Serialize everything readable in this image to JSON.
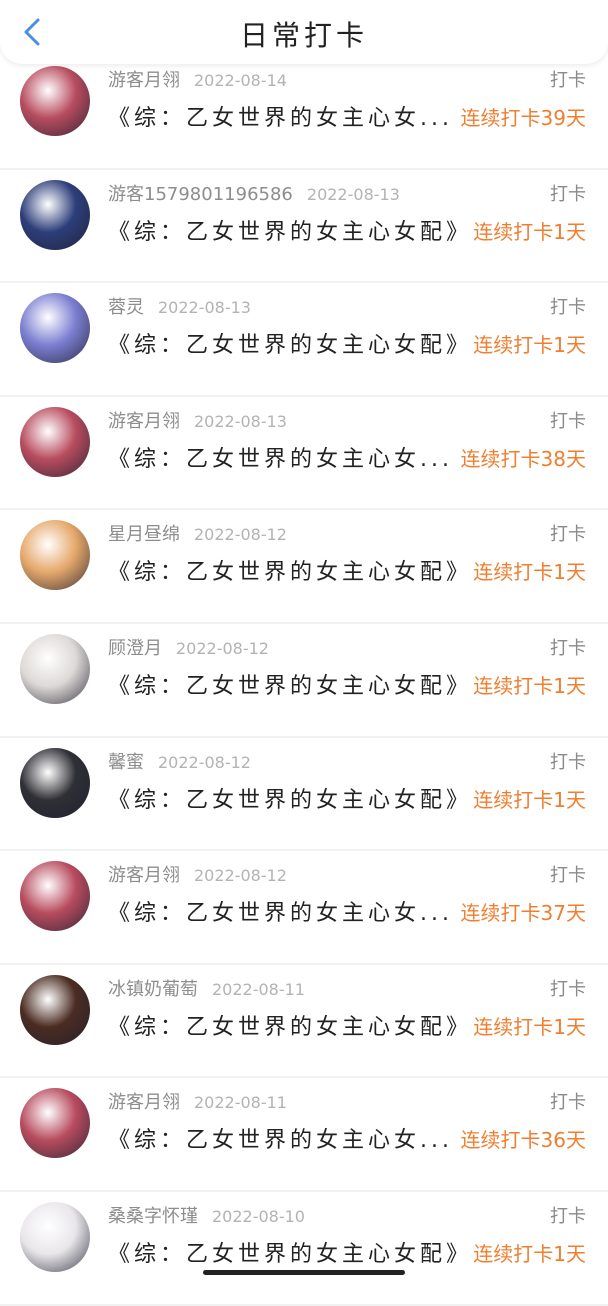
{
  "header": {
    "title": "日常打卡",
    "back_icon": "back-chevron-icon"
  },
  "colors": {
    "accent": "#4a90e2",
    "streak": "#f07e2f",
    "muted": "#8d8d8d"
  },
  "items": [
    {
      "name": "游客月翎",
      "date": "2022-08-14",
      "action": "打卡",
      "book": "《综：乙女世界的女主心女...",
      "streak": "连续打卡39天",
      "avatar": "#b84c5f"
    },
    {
      "name": "游客1579801196586",
      "date": "2022-08-13",
      "action": "打卡",
      "book": "《综：乙女世界的女主心女配》",
      "streak": "连续打卡1天",
      "avatar": "#2d3e7a"
    },
    {
      "name": "蓉灵",
      "date": "2022-08-13",
      "action": "打卡",
      "book": "《综：乙女世界的女主心女配》",
      "streak": "连续打卡1天",
      "avatar": "#7b7fd1"
    },
    {
      "name": "游客月翎",
      "date": "2022-08-13",
      "action": "打卡",
      "book": "《综：乙女世界的女主心女...",
      "streak": "连续打卡38天",
      "avatar": "#b84c5f"
    },
    {
      "name": "星月昼绵",
      "date": "2022-08-12",
      "action": "打卡",
      "book": "《综：乙女世界的女主心女配》",
      "streak": "连续打卡1天",
      "avatar": "#e6a86b"
    },
    {
      "name": "顾澄月",
      "date": "2022-08-12",
      "action": "打卡",
      "book": "《综：乙女世界的女主心女配》",
      "streak": "连续打卡1天",
      "avatar": "#ddd9d6"
    },
    {
      "name": "馨蜜",
      "date": "2022-08-12",
      "action": "打卡",
      "book": "《综：乙女世界的女主心女配》",
      "streak": "连续打卡1天",
      "avatar": "#2f2f36"
    },
    {
      "name": "游客月翎",
      "date": "2022-08-12",
      "action": "打卡",
      "book": "《综：乙女世界的女主心女...",
      "streak": "连续打卡37天",
      "avatar": "#b84c5f"
    },
    {
      "name": "冰镇奶葡萄",
      "date": "2022-08-11",
      "action": "打卡",
      "book": "《综：乙女世界的女主心女配》",
      "streak": "连续打卡1天",
      "avatar": "#4b2c22"
    },
    {
      "name": "游客月翎",
      "date": "2022-08-11",
      "action": "打卡",
      "book": "《综：乙女世界的女主心女...",
      "streak": "连续打卡36天",
      "avatar": "#b84c5f"
    },
    {
      "name": "桑桑字怀瑾",
      "date": "2022-08-10",
      "action": "打卡",
      "book": "《综：乙女世界的女主心女配》",
      "streak": "连续打卡1天",
      "avatar": "#e9e6ea"
    }
  ]
}
